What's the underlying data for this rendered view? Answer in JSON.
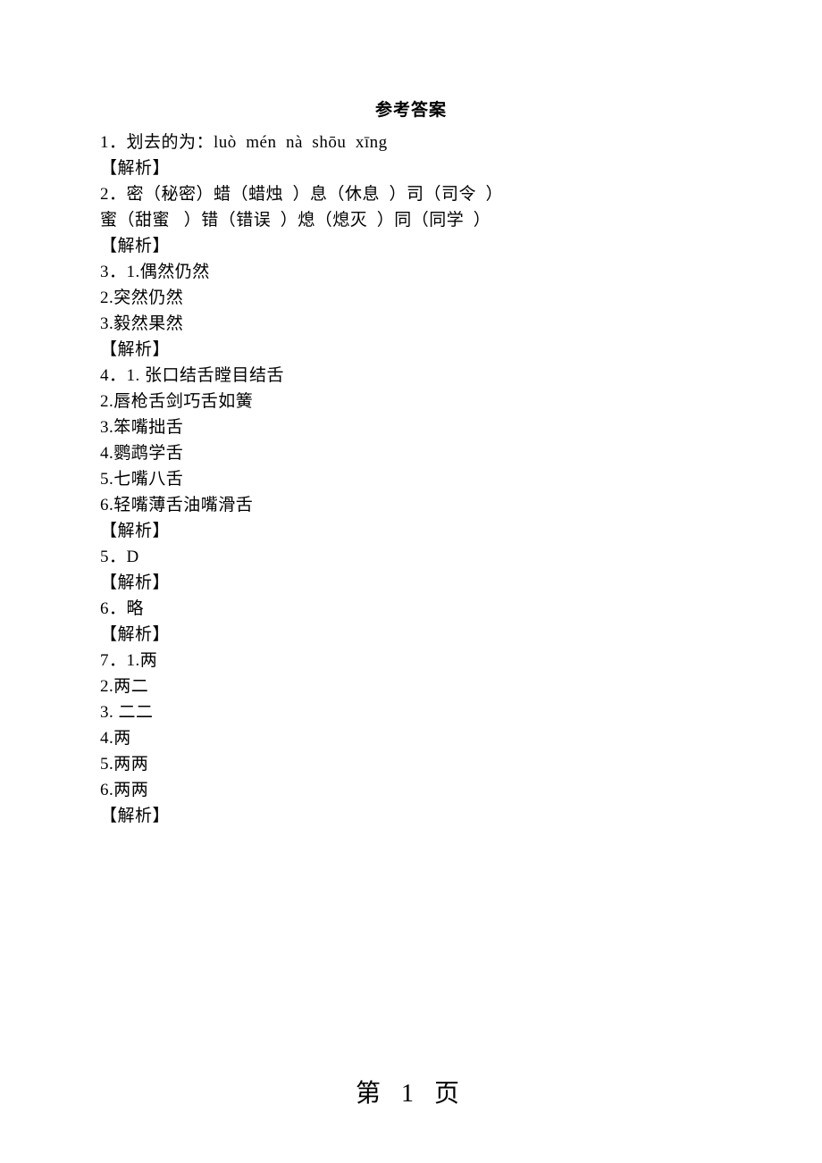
{
  "title": "参考答案",
  "lines": [
    "1．划去的为：luò  mén  nà  shōu  xīng",
    "【解析】",
    "2．密（秘密）蜡（蜡烛  ）息（休息  ）司（司令  ）",
    "蜜（甜蜜   ）错（错误  ）熄（熄灭  ）同（同学  ）",
    "【解析】",
    "3．1.偶然仍然",
    "2.突然仍然",
    "3.毅然果然",
    "【解析】",
    "4．1. 张口结舌瞠目结舌",
    "2.唇枪舌剑巧舌如簧",
    "3.笨嘴拙舌",
    "4.鹦鹉学舌",
    "5.七嘴八舌",
    "6.轻嘴薄舌油嘴滑舌",
    "【解析】",
    "5．D",
    "【解析】",
    "6．略",
    "【解析】",
    "7．1.两",
    "2.两二",
    "3. 二二",
    "4.两",
    "5.两两",
    "6.两两",
    "【解析】"
  ],
  "footer": "第 1 页"
}
